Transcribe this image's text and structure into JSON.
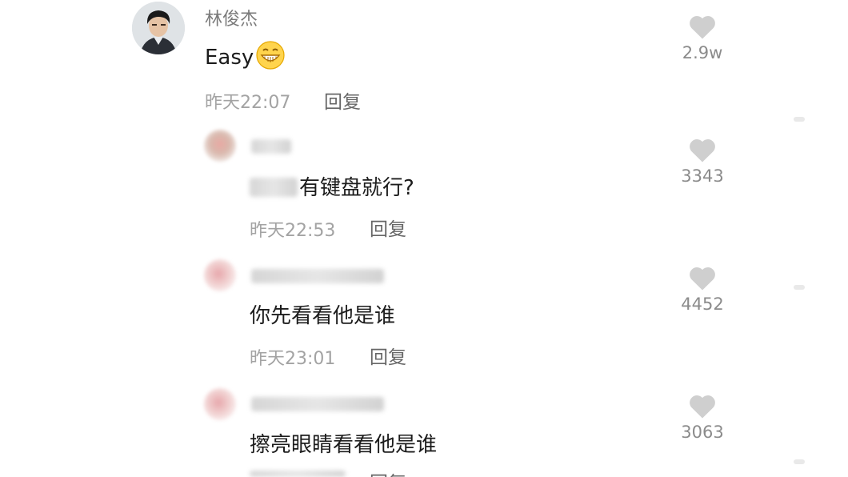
{
  "top_comment": {
    "author": "林俊杰",
    "text": "Easy",
    "emoji": "grinning-face-emoji",
    "time": "昨天22:07",
    "reply_label": "回复",
    "likes": "2.9w"
  },
  "replies": [
    {
      "text_visible": "有键盘就行?",
      "time": "昨天22:53",
      "reply_label": "回复",
      "likes": "3343"
    },
    {
      "text": "你先看看他是谁",
      "time": "昨天23:01",
      "reply_label": "回复",
      "likes": "4452"
    },
    {
      "text": "擦亮眼睛看看他是谁",
      "reply_label": "回复",
      "likes": "3063"
    }
  ],
  "colors": {
    "heart": "#cfcfcf",
    "meta_text": "#a3a3a3",
    "author_text": "#7a7a7a"
  }
}
